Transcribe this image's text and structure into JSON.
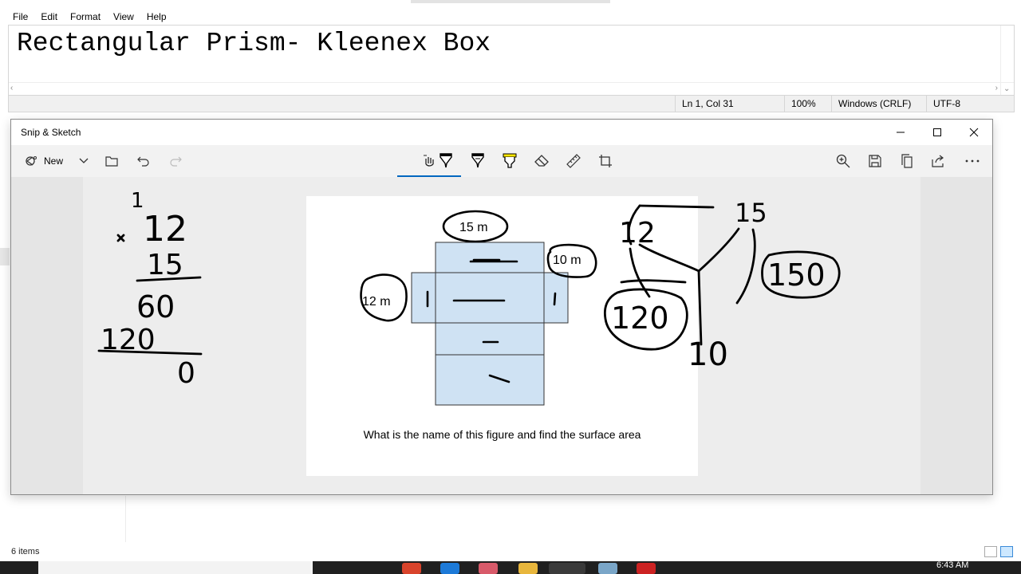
{
  "notepad": {
    "menu": [
      "File",
      "Edit",
      "Format",
      "View",
      "Help"
    ],
    "text": "Rectangular Prism- Kleenex Box",
    "status": {
      "position": "Ln 1, Col 31",
      "zoom": "100%",
      "line_ending": "Windows (CRLF)",
      "encoding": "UTF-8"
    }
  },
  "snip": {
    "title": "Snip & Sketch",
    "new_label": "New",
    "toolbar_icons": [
      "touch-writing-icon",
      "ballpoint-pen-icon",
      "pencil-icon",
      "highlighter-icon",
      "eraser-icon",
      "ruler-icon",
      "crop-icon"
    ],
    "right_icons": [
      "zoom-icon",
      "save-icon",
      "copy-icon",
      "share-icon",
      "more-icon"
    ],
    "figure": {
      "labels": {
        "top": "15 m",
        "right": "10 m",
        "left": "12 m"
      },
      "question": "What is the name of this figure and find the surface area"
    },
    "handwriting": {
      "multiplication": [
        "1",
        "12",
        "15",
        "60",
        "120",
        "0"
      ],
      "right_numbers": [
        "12",
        "15",
        "10",
        "120",
        "150"
      ]
    }
  },
  "explorer": {
    "items_count": "6 items"
  },
  "taskbar": {
    "time": "6:43 AM"
  },
  "colors": {
    "net_fill": "#cfe2f3",
    "accent": "#0067c0"
  }
}
